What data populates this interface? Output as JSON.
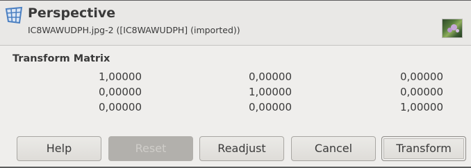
{
  "header": {
    "title": "Perspective",
    "subtitle": "IC8WAWUDPH.jpg-2 ([IC8WAWUDPH] (imported))",
    "icon": "perspective-tool-icon"
  },
  "matrix": {
    "title": "Transform Matrix",
    "rows": [
      [
        "1,00000",
        "0,00000",
        "0,00000"
      ],
      [
        "0,00000",
        "1,00000",
        "0,00000"
      ],
      [
        "0,00000",
        "0,00000",
        "1,00000"
      ]
    ]
  },
  "buttons": {
    "help": "Help",
    "reset": "Reset",
    "readjust": "Readjust",
    "cancel": "Cancel",
    "transform": "Transform"
  },
  "colors": {
    "background": "#efeeec",
    "header_background": "#e9e8e6",
    "icon_accent": "#4a7fc1",
    "disabled_button": "#b2b0ac"
  }
}
